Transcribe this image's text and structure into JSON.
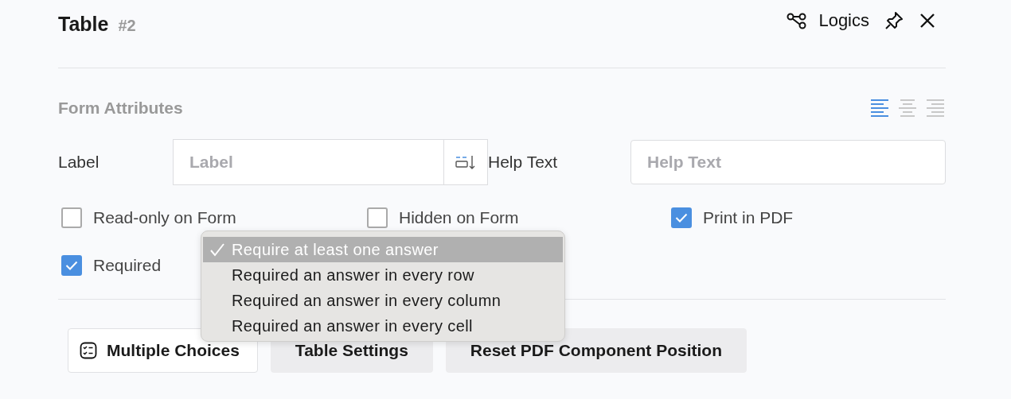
{
  "header": {
    "title": "Table",
    "number": "#2",
    "logics_button": "Logics"
  },
  "section": {
    "title": "Form Attributes",
    "alignment": [
      {
        "kind": "left",
        "selected": true
      },
      {
        "kind": "center",
        "selected": false
      },
      {
        "kind": "right",
        "selected": false
      }
    ]
  },
  "fields": [
    {
      "label": "Label",
      "placeholder": "Label",
      "kind": "with-picker"
    },
    {
      "label": "Help Text",
      "placeholder": "Help Text",
      "kind": "plain"
    }
  ],
  "options": [
    {
      "label": "Read-only on Form",
      "checked": false
    },
    {
      "label": "Hidden on Form",
      "checked": false
    },
    {
      "label": "Print in PDF",
      "checked": true
    },
    {
      "label": "Required",
      "checked": true
    }
  ],
  "menu": {
    "items": [
      {
        "label": "Require at least one answer",
        "selected": true
      },
      {
        "label": "Required an answer in every row",
        "selected": false
      },
      {
        "label": "Required an answer in every column",
        "selected": false
      },
      {
        "label": "Required an answer in every cell",
        "selected": false
      }
    ]
  },
  "buttons": [
    {
      "label": "Multiple Choices",
      "kind": "icon"
    },
    {
      "label": "Table Settings",
      "kind": "plain"
    },
    {
      "label": "Reset PDF Component Position",
      "kind": "plain"
    }
  ]
}
